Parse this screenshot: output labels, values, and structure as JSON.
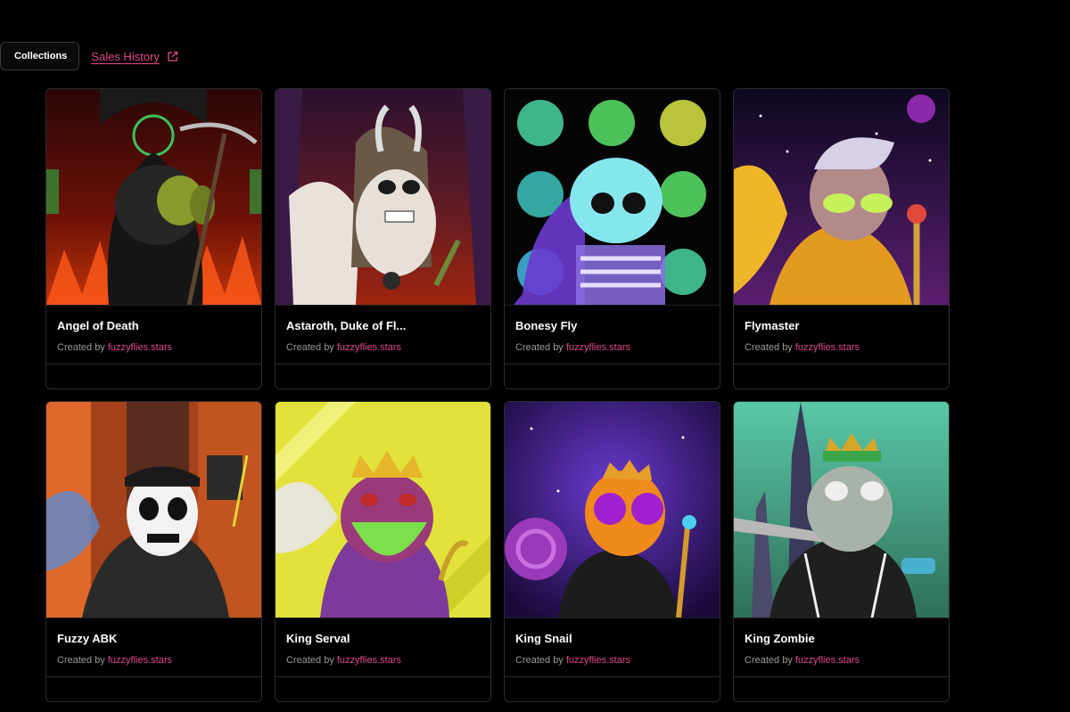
{
  "tabs": {
    "collections_label": "Collections",
    "sales_history_label": "Sales History",
    "sales_history_icon": "external-link-icon"
  },
  "colors": {
    "accent": "#e2478f",
    "background": "#000000",
    "card_border": "#2c2c2c"
  },
  "cards": [
    {
      "title": "Angel of Death",
      "created_by": "Created by",
      "creator": "fuzzyflies.stars"
    },
    {
      "title": "Astaroth, Duke of Fl...",
      "created_by": "Created by",
      "creator": "fuzzyflies.stars"
    },
    {
      "title": "Bonesy Fly",
      "created_by": "Created by",
      "creator": "fuzzyflies.stars"
    },
    {
      "title": "Flymaster",
      "created_by": "Created by",
      "creator": "fuzzyflies.stars"
    },
    {
      "title": "Fuzzy ABK",
      "created_by": "Created by",
      "creator": "fuzzyflies.stars"
    },
    {
      "title": "King Serval",
      "created_by": "Created by",
      "creator": "fuzzyflies.stars"
    },
    {
      "title": "King Snail",
      "created_by": "Created by",
      "creator": "fuzzyflies.stars"
    },
    {
      "title": "King Zombie",
      "created_by": "Created by",
      "creator": "fuzzyflies.stars"
    }
  ]
}
